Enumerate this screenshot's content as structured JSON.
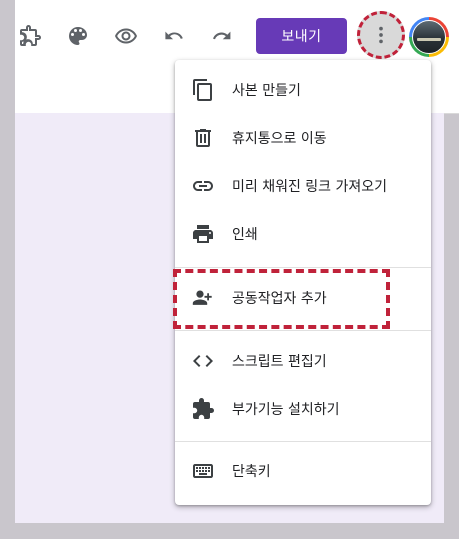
{
  "toolbar": {
    "send_label": "보내기",
    "icons": [
      "addons-icon",
      "palette-icon",
      "eye-icon",
      "undo-icon",
      "redo-icon",
      "more-vert-icon"
    ]
  },
  "menu": {
    "items": [
      {
        "label": "사본 만들기",
        "icon": "copy-icon"
      },
      {
        "label": "휴지통으로 이동",
        "icon": "trash-icon"
      },
      {
        "label": "미리 채워진 링크 가져오기",
        "icon": "link-icon"
      },
      {
        "label": "인쇄",
        "icon": "print-icon"
      },
      {
        "label": "공동작업자 추가",
        "icon": "person-add-icon"
      },
      {
        "label": "스크립트 편집기",
        "icon": "code-icon"
      },
      {
        "label": "부가기능 설치하기",
        "icon": "puzzle-icon"
      },
      {
        "label": "단축키",
        "icon": "keyboard-icon"
      }
    ]
  },
  "colors": {
    "accent": "#673ab7",
    "highlight": "#c0223a",
    "canvas": "#f0ebf8"
  }
}
